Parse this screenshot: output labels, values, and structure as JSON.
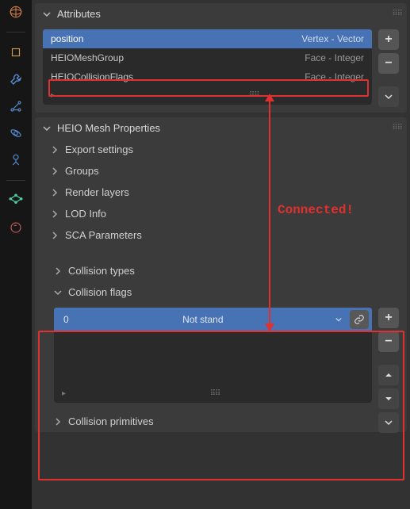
{
  "tabs": {
    "world": "world-tab",
    "object": "object-tab",
    "wrench": "modifiers-tab",
    "curve": "constraints-tab",
    "particle": "particles-tab",
    "physics": "physics-tab",
    "mesh": "mesh-data-tab",
    "material": "material-tab"
  },
  "panels": {
    "attributes": {
      "title": "Attributes",
      "rows": [
        {
          "name": "position",
          "type": "Vertex - Vector",
          "selected": true
        },
        {
          "name": "HEIOMeshGroup",
          "type": "Face - Integer",
          "selected": false
        },
        {
          "name": "HEIOCollisionFlags",
          "type": "Face - Integer",
          "selected": false
        }
      ]
    },
    "heio": {
      "title": "HEIO Mesh Properties",
      "subs": [
        {
          "label": "Export settings"
        },
        {
          "label": "Groups"
        },
        {
          "label": "Render layers"
        },
        {
          "label": "LOD Info"
        },
        {
          "label": "SCA Parameters"
        }
      ],
      "coll_types": "Collision types",
      "coll_flags": {
        "title": "Collision flags",
        "row": {
          "index": "0",
          "name": "Not stand"
        }
      },
      "coll_prims": "Collision primitives"
    }
  },
  "annotation": {
    "connected": "Connected!"
  }
}
